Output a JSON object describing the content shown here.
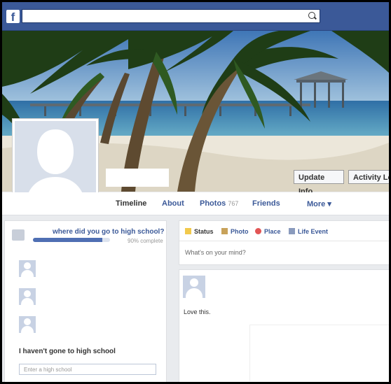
{
  "topbar": {
    "logo": "f",
    "search": {
      "placeholder": ""
    }
  },
  "cover": {
    "buttons": {
      "update_info": "Update Info",
      "activity_log": "Activity Log"
    }
  },
  "nav": {
    "timeline": "Timeline",
    "about": "About",
    "photos": "Photos",
    "photos_count": "767",
    "friends": "Friends",
    "more": "More ▾"
  },
  "school_prompt": {
    "question": "where did you go to high school?",
    "progress_label": "90% complete",
    "progress_value": 0.9,
    "no_high_school": "I haven't gone to high school",
    "input_placeholder": "Enter a high school"
  },
  "composer": {
    "tabs": [
      "Status",
      "Photo",
      "Place",
      "Life Event"
    ],
    "placeholder": "What's on your mind?"
  },
  "post": {
    "text": "Love this."
  },
  "colors": {
    "brand_blue": "#3b5998",
    "page_bg": "#e9ebee"
  },
  "icons": [
    "search-icon",
    "school-icon",
    "status-icon",
    "photo-icon",
    "place-icon",
    "life-event-icon"
  ]
}
